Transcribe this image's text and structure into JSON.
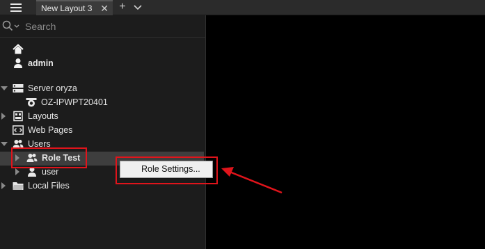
{
  "topbar": {
    "tab_label": "New Layout 3",
    "tab_close": "✕",
    "add_tab": "+"
  },
  "search": {
    "placeholder": "Search"
  },
  "tree": {
    "home": {
      "user_label": "admin"
    },
    "server": {
      "label": "Server oryza",
      "camera_label": "OZ-IPWPT20401"
    },
    "layouts_label": "Layouts",
    "web_pages_label": "Web Pages",
    "users": {
      "label": "Users",
      "items": [
        {
          "label": "Role Test"
        },
        {
          "label": "user"
        }
      ]
    },
    "local_files_label": "Local Files"
  },
  "context_menu": {
    "items": [
      {
        "label": "Role Settings..."
      }
    ]
  },
  "annotation": {
    "color": "#e0141b"
  }
}
